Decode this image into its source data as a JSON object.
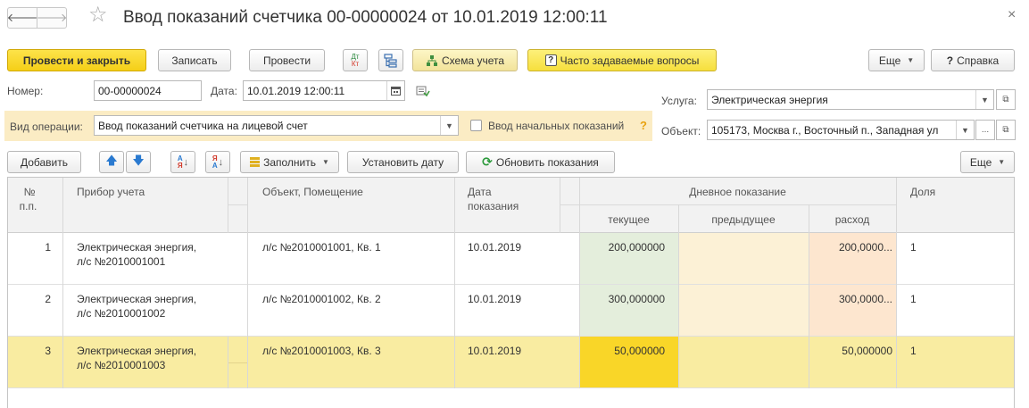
{
  "window": {
    "title": "Ввод показаний счетчика 00-00000024 от 10.01.2019 12:00:11",
    "back_glyph": "🡐",
    "forward_glyph": "🡒",
    "star_glyph": "☆",
    "close_glyph": "×"
  },
  "toolbar": {
    "post_close": "Провести и закрыть",
    "save": "Записать",
    "post": "Провести",
    "dtkt_top": "Дт",
    "dtkt_bottom": "Кт",
    "scheme": "Схема учета",
    "faq": "Часто задаваемые вопросы",
    "more": "Еще",
    "help": "Справка",
    "help_glyph": "?"
  },
  "form": {
    "number_label": "Номер:",
    "number_value": "00-00000024",
    "date_label": "Дата:",
    "date_value": "10.01.2019 12:00:11",
    "operation_label": "Вид операции:",
    "operation_value": "Ввод показаний счетчика на лицевой счет",
    "initial_label": "Ввод начальных показаний",
    "initial_checked": false,
    "help_mark": "?",
    "service_label": "Услуга:",
    "service_value": "Электрическая энергия",
    "object_label": "Объект:",
    "object_value": "105173, Москва г., Восточный п., Западная ул",
    "ellipsis": "..."
  },
  "table_toolbar": {
    "add": "Добавить",
    "up_glyph": "🡅",
    "down_glyph": "🡇",
    "sort_asc_top": "А",
    "sort_asc_bottom": "Я",
    "sort_desc_top": "Я",
    "sort_desc_bottom": "А",
    "fill": "Заполнить",
    "set_date": "Установить дату",
    "refresh": "Обновить показания",
    "refresh_glyph": "⟳",
    "more": "Еще"
  },
  "table": {
    "columns": {
      "num_line1": "№",
      "num_line2": "п.п.",
      "device": "Прибор учета",
      "object": "Объект, Помещение",
      "date_line1": "Дата",
      "date_line2": "показания",
      "day_reading": "Дневное показание",
      "current": "текущее",
      "previous": "предыдущее",
      "consumption": "расход",
      "share": "Доля"
    },
    "rows": [
      {
        "num": "1",
        "device_line1": "Электрическая энергия,",
        "device_line2": "л/с №2010001001",
        "object": "л/с №2010001001, Кв. 1",
        "date": "10.01.2019",
        "current": "200,000000",
        "previous": "",
        "consumption": "200,0000...",
        "share": "1"
      },
      {
        "num": "2",
        "device_line1": "Электрическая энергия,",
        "device_line2": "л/с №2010001002",
        "object": "л/с №2010001002, Кв. 2",
        "date": "10.01.2019",
        "current": "300,000000",
        "previous": "",
        "consumption": "300,0000...",
        "share": "1"
      },
      {
        "num": "3",
        "device_line1": "Электрическая энергия,",
        "device_line2": "л/с №2010001003",
        "object": "л/с №2010001003, Кв. 3",
        "date": "10.01.2019",
        "current": "50,000000",
        "previous": "",
        "consumption": "50,000000",
        "share": "1"
      }
    ]
  },
  "colors": {
    "primary": "#f5cf17",
    "operation_band": "#fbecc4",
    "selected_row": "#f9eca1",
    "current_col": "#e4eedc",
    "previous_col": "#fcf1d6",
    "consumption_col": "#fde6cf",
    "current_col_selected": "#f9d628"
  }
}
